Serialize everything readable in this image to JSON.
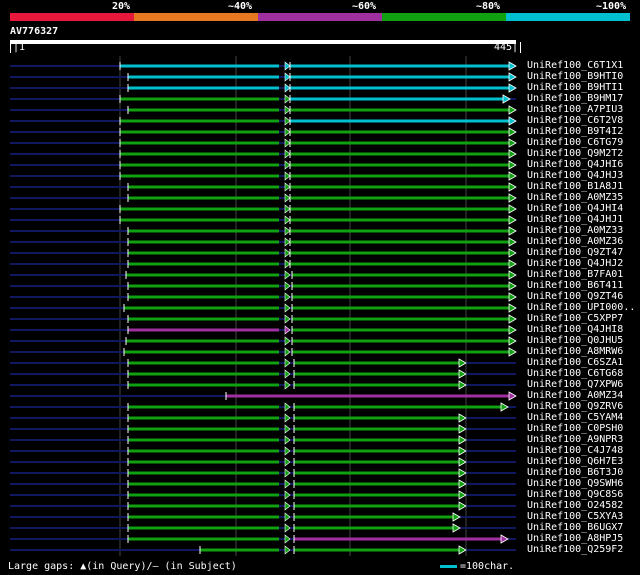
{
  "legend": {
    "labels": [
      "20%",
      "~40%",
      "~60%",
      "~80%",
      "~100%"
    ],
    "colors": [
      "#e8183c",
      "#e87820",
      "#a030a0",
      "#10a010",
      "#00c0d0"
    ]
  },
  "query": {
    "id": "AV776327",
    "start": "|1",
    "end": "445|"
  },
  "hits": [
    {
      "name": "UniRef100_C6T1X1",
      "segs": [
        [
          120,
          285,
          "cyan"
        ],
        [
          290,
          516,
          "cyan"
        ]
      ],
      "arrow": 516,
      "color": "cyan"
    },
    {
      "name": "UniRef100_B9HTI0",
      "segs": [
        [
          128,
          285,
          "cyan"
        ],
        [
          290,
          516,
          "cyan"
        ]
      ],
      "arrow": 516,
      "color": "cyan"
    },
    {
      "name": "UniRef100_B9HTI1",
      "segs": [
        [
          128,
          285,
          "cyan"
        ],
        [
          290,
          516,
          "cyan"
        ]
      ],
      "arrow": 516,
      "color": "cyan"
    },
    {
      "name": "UniRef100_B9HM17",
      "segs": [
        [
          120,
          285,
          "green"
        ],
        [
          290,
          510,
          "cyan"
        ]
      ],
      "arrow": 510,
      "color": "cyan"
    },
    {
      "name": "UniRef100_A7PIU3",
      "segs": [
        [
          128,
          285,
          "green"
        ],
        [
          290,
          516,
          "green"
        ]
      ],
      "arrow": 516,
      "color": "green"
    },
    {
      "name": "UniRef100_C6T2V8",
      "segs": [
        [
          120,
          285,
          "green"
        ],
        [
          290,
          516,
          "cyan"
        ]
      ],
      "arrow": 516,
      "color": "cyan"
    },
    {
      "name": "UniRef100_B9T4I2",
      "segs": [
        [
          120,
          285,
          "green"
        ],
        [
          290,
          516,
          "green"
        ]
      ],
      "arrow": 516,
      "color": "green"
    },
    {
      "name": "UniRef100_C6TG79",
      "segs": [
        [
          120,
          285,
          "green"
        ],
        [
          290,
          516,
          "green"
        ]
      ],
      "arrow": 516,
      "color": "green"
    },
    {
      "name": "UniRef100_Q9M2T2",
      "segs": [
        [
          120,
          285,
          "green"
        ],
        [
          290,
          516,
          "green"
        ]
      ],
      "arrow": 516,
      "color": "green"
    },
    {
      "name": "UniRef100_Q4JHI6",
      "segs": [
        [
          120,
          285,
          "green"
        ],
        [
          290,
          516,
          "green"
        ]
      ],
      "arrow": 516,
      "color": "green"
    },
    {
      "name": "UniRef100_Q4JHJ3",
      "segs": [
        [
          120,
          285,
          "green"
        ],
        [
          290,
          516,
          "green"
        ]
      ],
      "arrow": 516,
      "color": "green"
    },
    {
      "name": "UniRef100_B1A8J1",
      "segs": [
        [
          128,
          285,
          "green"
        ],
        [
          290,
          516,
          "green"
        ]
      ],
      "arrow": 516,
      "color": "green"
    },
    {
      "name": "UniRef100_A0MZ35",
      "segs": [
        [
          128,
          285,
          "green"
        ],
        [
          290,
          516,
          "green"
        ]
      ],
      "arrow": 516,
      "color": "green"
    },
    {
      "name": "UniRef100_Q4JHI4",
      "segs": [
        [
          120,
          285,
          "green"
        ],
        [
          290,
          516,
          "green"
        ]
      ],
      "arrow": 516,
      "color": "green"
    },
    {
      "name": "UniRef100_Q4JHJ1",
      "segs": [
        [
          120,
          285,
          "green"
        ],
        [
          290,
          516,
          "green"
        ]
      ],
      "arrow": 516,
      "color": "green"
    },
    {
      "name": "UniRef100_A0MZ33",
      "segs": [
        [
          128,
          285,
          "green"
        ],
        [
          290,
          516,
          "green"
        ]
      ],
      "arrow": 516,
      "color": "green"
    },
    {
      "name": "UniRef100_A0MZ36",
      "segs": [
        [
          128,
          285,
          "green"
        ],
        [
          290,
          516,
          "green"
        ]
      ],
      "arrow": 516,
      "color": "green"
    },
    {
      "name": "UniRef100_Q9ZT47",
      "segs": [
        [
          128,
          285,
          "green"
        ],
        [
          290,
          516,
          "green"
        ]
      ],
      "arrow": 516,
      "color": "green"
    },
    {
      "name": "UniRef100_Q4JHJ2",
      "segs": [
        [
          128,
          285,
          "green"
        ],
        [
          290,
          516,
          "green"
        ]
      ],
      "arrow": 516,
      "color": "green"
    },
    {
      "name": "UniRef100_B7FA01",
      "segs": [
        [
          126,
          285,
          "green"
        ],
        [
          292,
          516,
          "green"
        ]
      ],
      "arrow": 516,
      "color": "green"
    },
    {
      "name": "UniRef100_B6T411",
      "segs": [
        [
          128,
          285,
          "green"
        ],
        [
          292,
          516,
          "green"
        ]
      ],
      "arrow": 516,
      "color": "green"
    },
    {
      "name": "UniRef100_Q9ZT46",
      "segs": [
        [
          128,
          285,
          "green"
        ],
        [
          292,
          516,
          "green"
        ]
      ],
      "arrow": 516,
      "color": "green"
    },
    {
      "name": "UniRef100_UPI000..",
      "segs": [
        [
          124,
          285,
          "green"
        ],
        [
          292,
          516,
          "green"
        ]
      ],
      "arrow": 516,
      "color": "green"
    },
    {
      "name": "UniRef100_C5XPP7",
      "segs": [
        [
          128,
          285,
          "green"
        ],
        [
          292,
          516,
          "green"
        ]
      ],
      "arrow": 516,
      "color": "green"
    },
    {
      "name": "UniRef100_Q4JHI8",
      "segs": [
        [
          128,
          285,
          "purple"
        ],
        [
          292,
          516,
          "green"
        ]
      ],
      "arrow": 516,
      "color": "green"
    },
    {
      "name": "UniRef100_Q0JHU5",
      "segs": [
        [
          126,
          285,
          "green"
        ],
        [
          292,
          516,
          "green"
        ]
      ],
      "arrow": 516,
      "color": "green"
    },
    {
      "name": "UniRef100_A8MRW6",
      "segs": [
        [
          124,
          285,
          "green"
        ],
        [
          292,
          516,
          "green"
        ]
      ],
      "arrow": 516,
      "color": "green"
    },
    {
      "name": "UniRef100_C6SZA1",
      "segs": [
        [
          128,
          285,
          "green"
        ],
        [
          294,
          466,
          "green"
        ]
      ],
      "arrow": 466,
      "color": "green"
    },
    {
      "name": "UniRef100_C6TG68",
      "segs": [
        [
          128,
          285,
          "green"
        ],
        [
          294,
          466,
          "green"
        ]
      ],
      "arrow": 466,
      "color": "green"
    },
    {
      "name": "UniRef100_Q7XPW6",
      "segs": [
        [
          128,
          285,
          "green"
        ],
        [
          294,
          466,
          "green"
        ]
      ],
      "arrow": 466,
      "color": "green"
    },
    {
      "name": "UniRef100_A0MZ34",
      "segs": [
        [
          226,
          516,
          "purple"
        ]
      ],
      "arrow": 516,
      "color": "purple"
    },
    {
      "name": "UniRef100_Q9ZRV6",
      "segs": [
        [
          128,
          285,
          "green"
        ],
        [
          294,
          508,
          "green"
        ]
      ],
      "arrow": 508,
      "color": "green"
    },
    {
      "name": "UniRef100_C5YAM4",
      "segs": [
        [
          128,
          285,
          "green"
        ],
        [
          294,
          466,
          "green"
        ]
      ],
      "arrow": 466,
      "color": "green"
    },
    {
      "name": "UniRef100_C0PSH0",
      "segs": [
        [
          128,
          285,
          "green"
        ],
        [
          294,
          466,
          "green"
        ]
      ],
      "arrow": 466,
      "color": "green"
    },
    {
      "name": "UniRef100_A9NPR3",
      "segs": [
        [
          128,
          285,
          "green"
        ],
        [
          294,
          466,
          "green"
        ]
      ],
      "arrow": 466,
      "color": "green"
    },
    {
      "name": "UniRef100_C4J748",
      "segs": [
        [
          128,
          285,
          "green"
        ],
        [
          294,
          466,
          "green"
        ]
      ],
      "arrow": 466,
      "color": "green"
    },
    {
      "name": "UniRef100_Q6H7E3",
      "segs": [
        [
          128,
          285,
          "green"
        ],
        [
          294,
          466,
          "green"
        ]
      ],
      "arrow": 466,
      "color": "green"
    },
    {
      "name": "UniRef100_B6T3J0",
      "segs": [
        [
          128,
          285,
          "green"
        ],
        [
          294,
          466,
          "green"
        ]
      ],
      "arrow": 466,
      "color": "green"
    },
    {
      "name": "UniRef100_Q9SWH6",
      "segs": [
        [
          128,
          285,
          "green"
        ],
        [
          294,
          466,
          "green"
        ]
      ],
      "arrow": 466,
      "color": "green"
    },
    {
      "name": "UniRef100_Q9C8S6",
      "segs": [
        [
          128,
          285,
          "green"
        ],
        [
          294,
          466,
          "green"
        ]
      ],
      "arrow": 466,
      "color": "green"
    },
    {
      "name": "UniRef100_O24582",
      "segs": [
        [
          128,
          285,
          "green"
        ],
        [
          294,
          466,
          "green"
        ]
      ],
      "arrow": 466,
      "color": "green"
    },
    {
      "name": "UniRef100_C5XYA3",
      "segs": [
        [
          128,
          285,
          "green"
        ],
        [
          294,
          460,
          "green"
        ]
      ],
      "arrow": 460,
      "color": "green"
    },
    {
      "name": "UniRef100_B6UGX7",
      "segs": [
        [
          128,
          285,
          "green"
        ],
        [
          294,
          460,
          "green"
        ]
      ],
      "arrow": 460,
      "color": "green"
    },
    {
      "name": "UniRef100_A8HPJ5",
      "segs": [
        [
          128,
          285,
          "green"
        ],
        [
          294,
          508,
          "purple"
        ]
      ],
      "arrow": 508,
      "color": "purple"
    },
    {
      "name": "UniRef100_Q259F2",
      "segs": [
        [
          200,
          285,
          "green"
        ],
        [
          294,
          466,
          "green"
        ]
      ],
      "arrow": 466,
      "color": "green"
    }
  ],
  "footer": {
    "gaps_label": "Large gaps: ▲(in Query)/– (in Subject)",
    "scale_label": "=100char."
  }
}
